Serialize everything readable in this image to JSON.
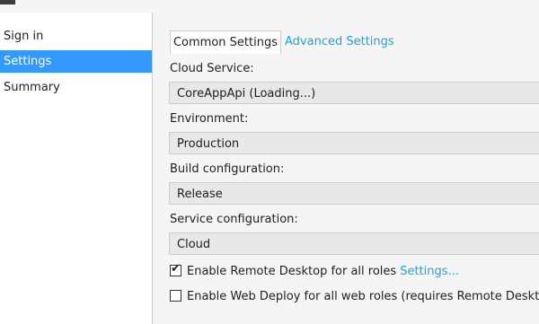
{
  "colors": {
    "accent": "#3399ff",
    "link": "#1ba1e2"
  },
  "sidebar": {
    "items": [
      {
        "label": "Sign in",
        "selected": false
      },
      {
        "label": "Settings",
        "selected": true
      },
      {
        "label": "Summary",
        "selected": false
      }
    ]
  },
  "tabs": [
    {
      "label": "Common Settings",
      "active": true
    },
    {
      "label": "Advanced Settings",
      "active": false
    }
  ],
  "form": {
    "cloud_service": {
      "label": "Cloud Service:",
      "value": "CoreAppApi (Loading...)"
    },
    "environment": {
      "label": "Environment:",
      "value": "Production"
    },
    "build_configuration": {
      "label": "Build configuration:",
      "value": "Release"
    },
    "service_configuration": {
      "label": "Service configuration:",
      "value": "Cloud"
    },
    "remote_desktop": {
      "label": "Enable Remote Desktop for all roles",
      "checked": true,
      "link_label": "Settings..."
    },
    "web_deploy": {
      "label": "Enable Web Deploy for all web roles (requires Remote Desktop)",
      "checked": false
    }
  }
}
